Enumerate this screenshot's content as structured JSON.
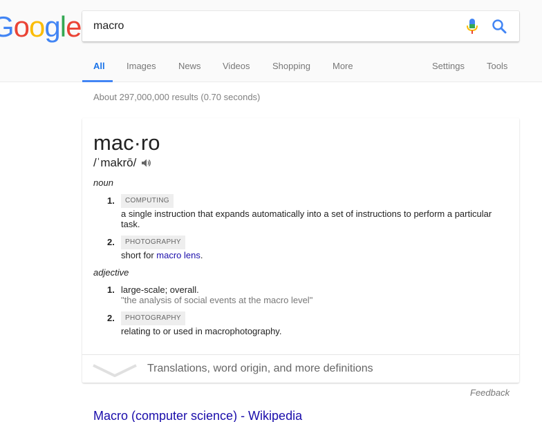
{
  "logo": {
    "letters": [
      "G",
      "o",
      "o",
      "g",
      "l",
      "e"
    ],
    "colors": [
      "#4285F4",
      "#EA4335",
      "#FBBC05",
      "#4285F4",
      "#34A853",
      "#EA4335"
    ]
  },
  "search": {
    "query": "macro",
    "mic_icon": "mic-icon",
    "search_icon": "search-icon"
  },
  "tabs": [
    {
      "label": "All",
      "active": true
    },
    {
      "label": "Images"
    },
    {
      "label": "News"
    },
    {
      "label": "Videos"
    },
    {
      "label": "Shopping"
    },
    {
      "label": "More"
    },
    {
      "label": "Settings"
    },
    {
      "label": "Tools"
    }
  ],
  "result_stats": "About 297,000,000 results (0.70 seconds)",
  "dictionary": {
    "headword": "mac·ro",
    "pronunciation": "/ˈmakrō/",
    "noun": {
      "label": "noun",
      "defs": [
        {
          "num": "1.",
          "domain": "COMPUTING",
          "text": "a single instruction that expands automatically into a set of instructions to perform a particular task."
        },
        {
          "num": "2.",
          "domain": "PHOTOGRAPHY",
          "text_prefix": "short for ",
          "link": "macro lens",
          "text_suffix": "."
        }
      ]
    },
    "adjective": {
      "label": "adjective",
      "defs": [
        {
          "num": "1.",
          "text": "large-scale; overall.",
          "example": "\"the analysis of social events at the macro level\""
        },
        {
          "num": "2.",
          "domain": "PHOTOGRAPHY",
          "text": "relating to or used in macrophotography."
        }
      ]
    },
    "more_text": "Translations, word origin, and more definitions"
  },
  "feedback": "Feedback",
  "first_result": {
    "title": "Macro (computer science) - Wikipedia"
  },
  "colors": {
    "accent": "#4285F4",
    "link": "#1A0DAB"
  }
}
